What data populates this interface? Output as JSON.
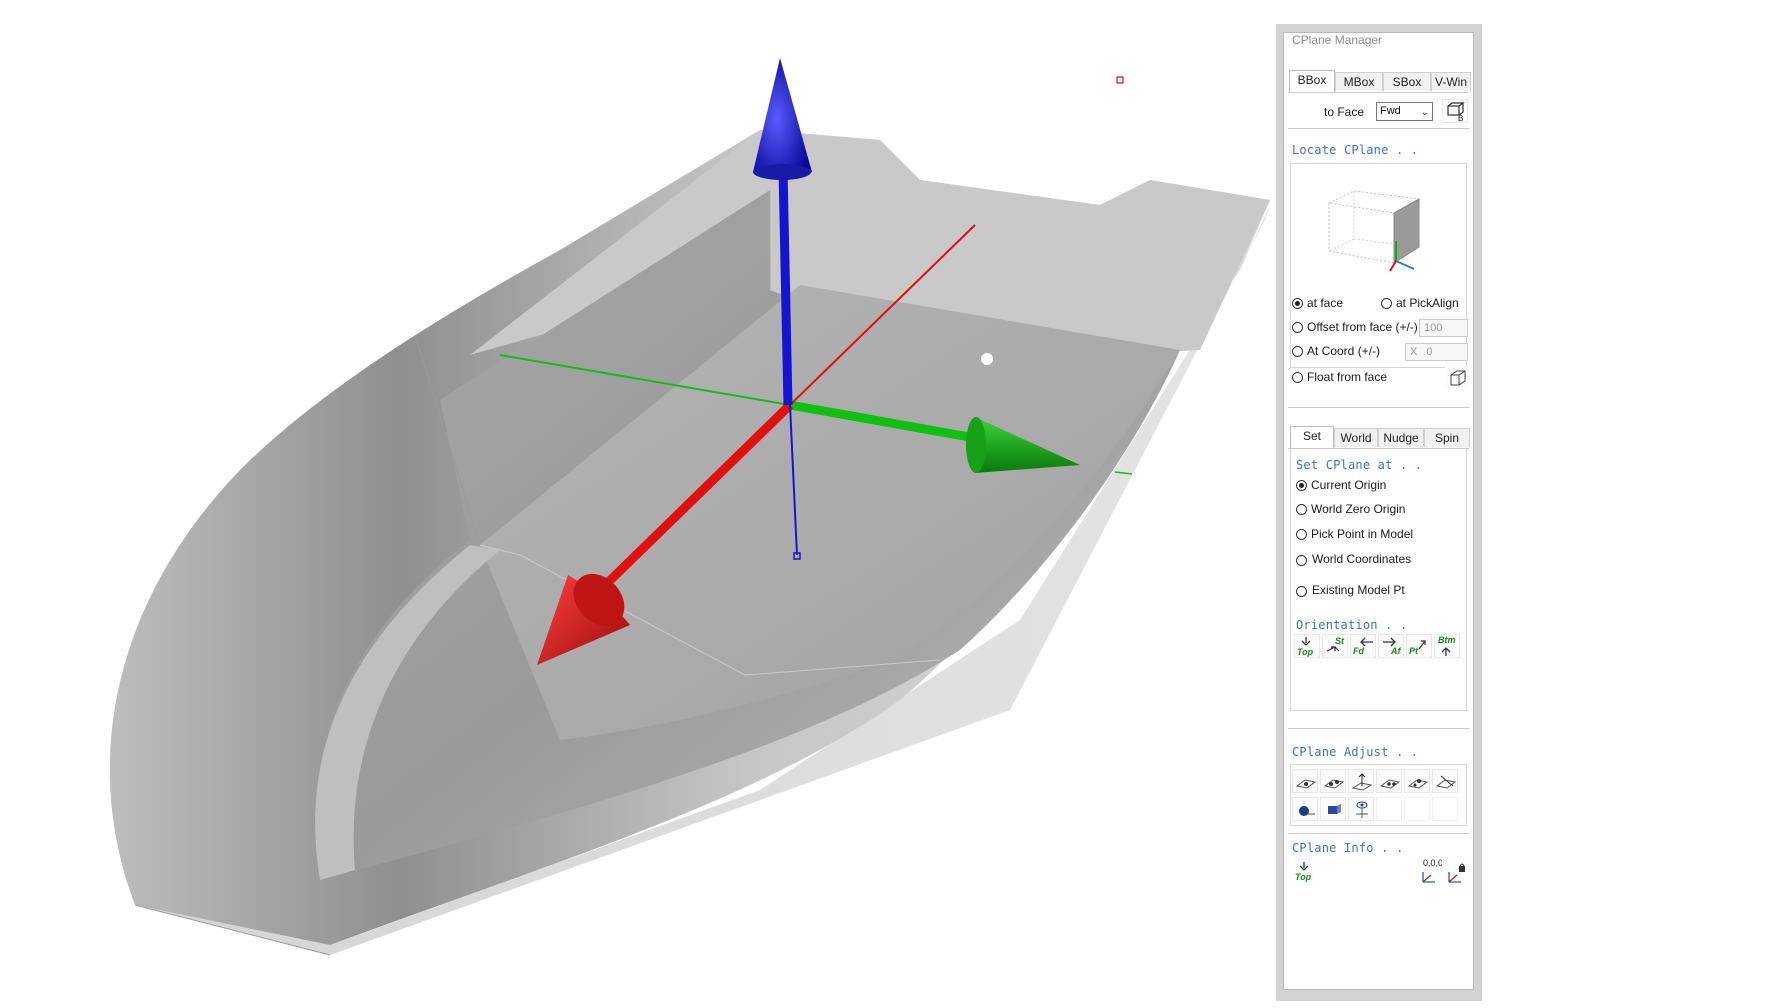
{
  "colors": {
    "x_axis": "#e01010",
    "y_axis": "#10b010",
    "z_axis": "#1515d0",
    "section_title": "#3b6fd1",
    "hull": "#b5b5b5"
  },
  "viewport": {
    "description_icon": "boat-hull-model"
  },
  "panel": {
    "title": "CPlane Manager",
    "top_tabs": [
      {
        "label": "BBox",
        "active": true
      },
      {
        "label": "MBox",
        "active": false
      },
      {
        "label": "SBox",
        "active": false
      },
      {
        "label": "V-Win",
        "active": false
      }
    ],
    "to_face_label": "to Face",
    "to_face_value": "Fwd",
    "locate_title": "Locate CPlane . .",
    "options": {
      "at_face": "at face",
      "at_pickalign": "at PickAlign",
      "offset_from_face": "Offset from face (+/-)",
      "offset_value": "100",
      "at_coord": "At Coord (+/-)",
      "coord_axis": "X",
      "coord_value": "0",
      "float_from_face": "Float from face"
    },
    "set_tabs": [
      {
        "label": "Set",
        "active": true
      },
      {
        "label": "World",
        "active": false
      },
      {
        "label": "Nudge",
        "active": false
      },
      {
        "label": "Spin",
        "active": false
      }
    ],
    "set_title": "Set CPlane at . .",
    "set_options": [
      {
        "label": "Current Origin",
        "checked": true
      },
      {
        "label": "World Zero Origin",
        "checked": false
      },
      {
        "label": "Pick Point in Model",
        "checked": false
      },
      {
        "label": "World Coordinates",
        "checked": false
      },
      {
        "label": "Existing Model Pt",
        "checked": false
      }
    ],
    "orientation_title": "Orientation . .",
    "orientation_buttons": [
      "Top",
      "St",
      "Fd",
      "Af",
      "Pt",
      "Btm"
    ],
    "adjust_title": "CPlane Adjust . .",
    "info_title": "CPlane Info . .",
    "info_top_label": "Top",
    "info_origin_label": "0,0,0"
  }
}
